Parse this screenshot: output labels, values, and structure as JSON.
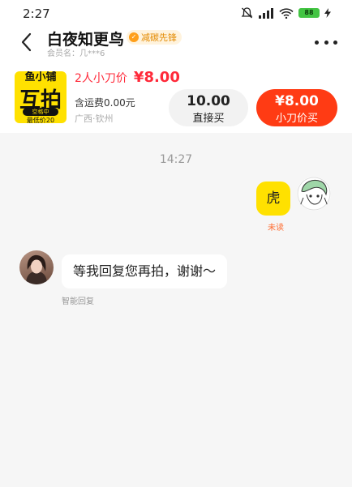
{
  "status_bar": {
    "time": "2:27",
    "battery": "88"
  },
  "header": {
    "shop_name": "白夜知更鸟",
    "badge_label": "减碳先锋",
    "member_label": "会员名：几***6"
  },
  "product": {
    "thumb_line1": "鱼小铺",
    "thumb_line2": "互拍",
    "thumb_line3": "空格中",
    "thumb_line4": "最低价20",
    "deal_label": "2人小刀价",
    "deal_price": "¥8.00",
    "shipping": "含运费0.00元",
    "location": "广西·钦州",
    "direct_price": "10.00",
    "direct_label": "直接买",
    "cut_price": "¥8.00",
    "cut_label": "小刀价买"
  },
  "chat": {
    "time_divider": "14:27",
    "messages": [
      {
        "from": "me",
        "text": "虎",
        "status": "未读"
      },
      {
        "from": "seller",
        "text": "等我回复您再拍，谢谢～",
        "note": "智能回复"
      }
    ]
  },
  "colors": {
    "accent_red": "#ff3b14",
    "price_red": "#ff2a3a",
    "yellow": "#ffe100",
    "badge_orange": "#e38a00"
  },
  "icons": [
    "mute-icon",
    "signal-icon",
    "wifi-icon",
    "battery-icon",
    "charging-icon",
    "back-icon",
    "more-icon"
  ]
}
